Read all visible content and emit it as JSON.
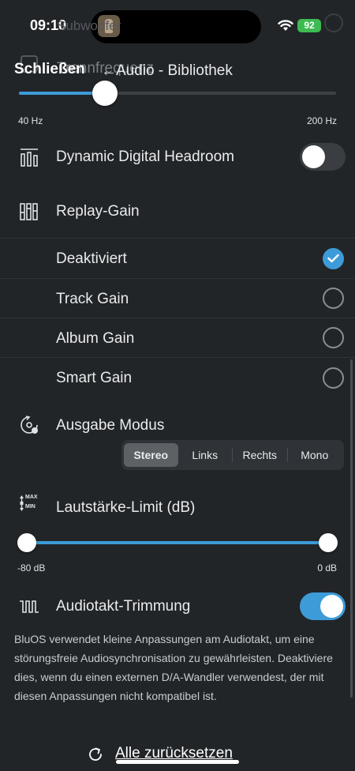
{
  "status_bar": {
    "time": "09:10",
    "battery": "92"
  },
  "header": {
    "behind_title": "Subwoofer",
    "behind_freq_label": "Trennfrequenz",
    "close_label": "Schließen",
    "back_icon": "arrow-left-icon",
    "title": "Audio - Bibliothek"
  },
  "crossover_slider": {
    "min_label": "40 Hz",
    "max_label": "200 Hz",
    "value_fraction": 0.27
  },
  "ddh": {
    "label": "Dynamic Digital Headroom",
    "enabled": false
  },
  "replay_gain": {
    "label": "Replay-Gain",
    "options": [
      {
        "label": "Deaktiviert",
        "selected": true
      },
      {
        "label": "Track Gain",
        "selected": false
      },
      {
        "label": "Album Gain",
        "selected": false
      },
      {
        "label": "Smart Gain",
        "selected": false
      }
    ]
  },
  "output_mode": {
    "label": "Ausgabe Modus",
    "options": [
      "Stereo",
      "Links",
      "Rechts",
      "Mono"
    ],
    "selected": "Stereo"
  },
  "volume_limit": {
    "label": "Lautstärke-Limit (dB)",
    "icon_max": "MAX",
    "icon_min": "MIN",
    "min_label": "-80 dB",
    "max_label": "0 dB",
    "low_value_db": -80,
    "high_value_db": 0
  },
  "clock_trim": {
    "label": "Audiotakt-Trimmung",
    "enabled": true,
    "description": "BluOS verwendet kleine Anpassungen am Audiotakt, um eine störungsfreie Audiosynchronisation zu gewährleisten. Deaktiviere dies, wenn du einen externen D/A-Wandler verwendest, der mit diesen Anpassungen nicht kompatibel ist."
  },
  "reset": {
    "label": "Alle zurücksetzen"
  },
  "colors": {
    "accent": "#3d9bd8",
    "background": "#222528"
  }
}
